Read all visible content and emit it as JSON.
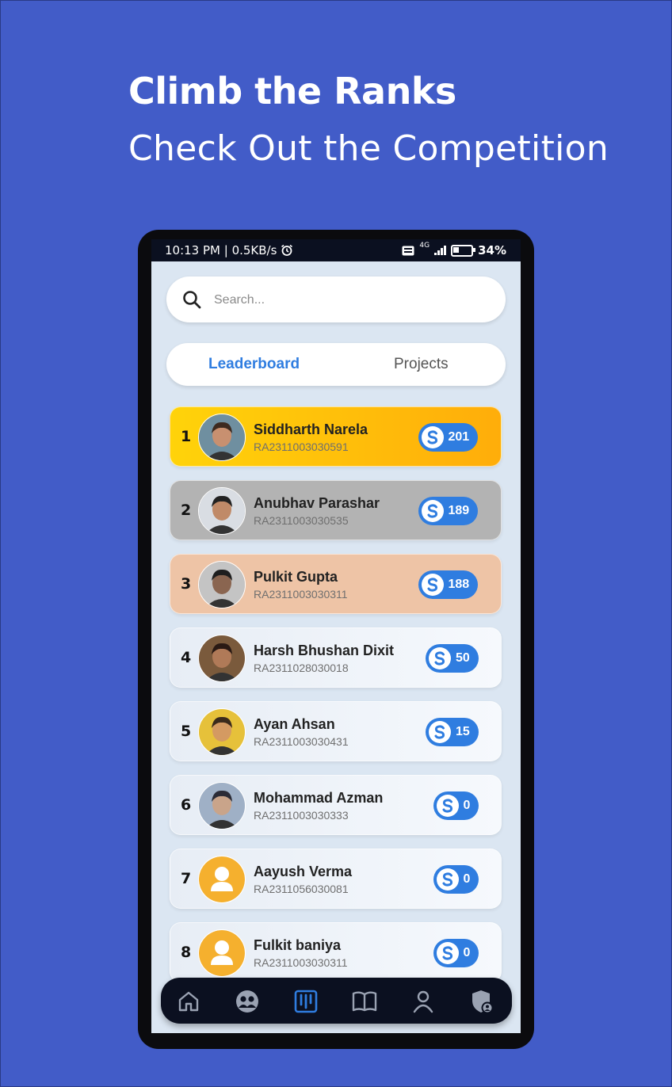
{
  "promo": {
    "headline": "Climb the Ranks",
    "subheadline": "Check Out the Competition"
  },
  "statusbar": {
    "left_text": "10:13 PM | 0.5KB/s",
    "network": "4G",
    "battery": "34%"
  },
  "search": {
    "placeholder": "Search..."
  },
  "tabs": [
    {
      "label": "Leaderboard",
      "active": true
    },
    {
      "label": "Projects",
      "active": false
    }
  ],
  "leaderboard": [
    {
      "rank": "1",
      "name": "Siddharth Narela",
      "id": "RA2311003030591",
      "score": "201",
      "highlight": "gold"
    },
    {
      "rank": "2",
      "name": "Anubhav Parashar",
      "id": "RA2311003030535",
      "score": "189",
      "highlight": "silver"
    },
    {
      "rank": "3",
      "name": "Pulkit Gupta",
      "id": "RA2311003030311",
      "score": "188",
      "highlight": "bronze"
    },
    {
      "rank": "4",
      "name": "Harsh Bhushan Dixit",
      "id": "RA2311028030018",
      "score": "50",
      "highlight": "none"
    },
    {
      "rank": "5",
      "name": "Ayan Ahsan",
      "id": "RA2311003030431",
      "score": "15",
      "highlight": "none"
    },
    {
      "rank": "6",
      "name": "Mohammad Azman",
      "id": "RA2311003030333",
      "score": "0",
      "highlight": "none"
    },
    {
      "rank": "7",
      "name": "Aayush Verma",
      "id": "RA2311056030081",
      "score": "0",
      "highlight": "none"
    },
    {
      "rank": "8",
      "name": "Fulkit baniya",
      "id": "RA2311003030311",
      "score": "0",
      "highlight": "none"
    }
  ],
  "navbar": {
    "items": [
      "home-icon",
      "community-icon",
      "leaderboard-icon",
      "book-icon",
      "profile-icon",
      "admin-shield-icon"
    ],
    "active": "leaderboard-icon"
  },
  "colors": {
    "background": "#425cc8",
    "accent": "#2f7de0",
    "gold": "#ffc20a",
    "silver": "#b3b3b3",
    "bronze": "#eec4a6",
    "navbar": "#0b1020"
  }
}
